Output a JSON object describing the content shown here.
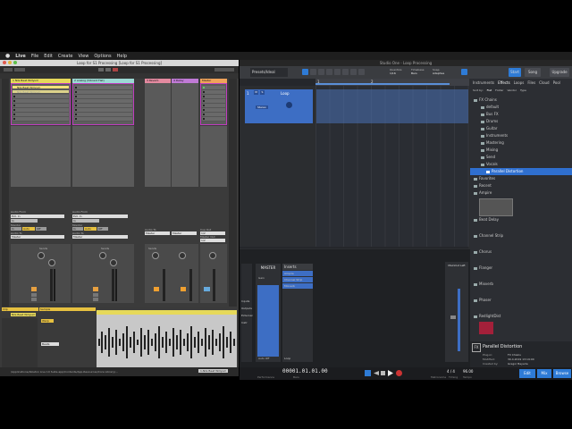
{
  "menubar": {
    "app": "Live",
    "items": [
      "File",
      "Edit",
      "Create",
      "View",
      "Options",
      "Help"
    ]
  },
  "ableton": {
    "window_title": "Loop for S1 Processing [Loop for S1 Processing]",
    "tracks": [
      {
        "name": "1 Nils Beat Willyum",
        "color": "#e6d95a"
      },
      {
        "name": "2 analog (Vibrant Flat)",
        "color": "#9cd9d4"
      },
      {
        "name": "3 Reverb",
        "color": "#e48aa0"
      },
      {
        "name": "4 Delay",
        "color": "#c07ad6"
      },
      {
        "name": "Master",
        "color": "#f0a35a"
      }
    ],
    "clips": {
      "selected": "Nils Beat Willyum",
      "second": "Nils Beat Willyum"
    },
    "io": {
      "audio_from": "Audio From",
      "ext_in": "Ext. In",
      "monitor": "Monitor",
      "in": "In",
      "auto": "Auto",
      "off": "Off",
      "audio_to": "Audio To",
      "master": "Master",
      "sends": "Sends",
      "cue_out": "Cue Out",
      "master_out": "Master Out"
    },
    "clip_view": {
      "label": "Clip",
      "clip_name": "Nils Beat Willyum",
      "sample": "Sample",
      "warp": "Warp",
      "beats": "Beats"
    },
    "status": {
      "path": "/Applications/Ableton Live 10 Suite.app/Contents/App-Resources/Core Library/...",
      "track": "1-Nils Beat Willyum"
    }
  },
  "studio_one": {
    "window_title": "Studio One - Loop Processing",
    "toolbar": {
      "preset": "Presets/Ideal",
      "quantize_label": "Quantize",
      "quantize_value": "1/16",
      "timebase_label": "Timebase",
      "timebase_value": "Bars",
      "snap_label": "Snap",
      "snap_value": "Adaptive",
      "start": "Start",
      "song": "Song",
      "project": "Project",
      "upgrade": "Upgrade"
    },
    "track": {
      "number": "1",
      "name": "Loop",
      "mode": "Stereo"
    },
    "ruler_marks": [
      "1",
      "2"
    ],
    "browser": {
      "tabs": [
        "Instruments",
        "Effects",
        "Loops",
        "Files",
        "Cloud",
        "Pool"
      ],
      "selected_tab": "Effects",
      "sort_label": "Sort by:",
      "sort_options": [
        "Flat",
        "Folder",
        "Vendor",
        "Type"
      ],
      "tree": [
        {
          "label": "FX Chains",
          "level": 0
        },
        {
          "label": "default",
          "level": 1
        },
        {
          "label": "Bus FX",
          "level": 1
        },
        {
          "label": "Drums",
          "level": 1
        },
        {
          "label": "Guitar",
          "level": 1
        },
        {
          "label": "Instruments",
          "level": 1
        },
        {
          "label": "Mastering",
          "level": 1
        },
        {
          "label": "Mixing",
          "level": 1
        },
        {
          "label": "Send",
          "level": 1
        },
        {
          "label": "Vocals",
          "level": 1
        },
        {
          "label": "Parallel Distortion",
          "level": 2,
          "selected": true
        },
        {
          "label": "Favorites",
          "level": 0
        },
        {
          "label": "Recent",
          "level": 0
        },
        {
          "label": "Ampire",
          "level": 0
        }
      ],
      "chain_items": [
        "Beat Delay",
        "Channel Strip",
        "Chorus",
        "Flanger",
        "Mixverb",
        "Phaser",
        "RedlightDist"
      ],
      "info": {
        "title": "Parallel Distortion",
        "plugin_label": "Plug-in:",
        "plugin_value": "FX Chains",
        "modified_label": "Modified:",
        "modified_value": "30.4.2019 13:19:00",
        "created_label": "Created by:",
        "created_value": "Gregor Beyerle"
      }
    },
    "mixer": {
      "channel_name": "MASTER",
      "inserts_label": "Inserts",
      "inserts": [
        "Ampire",
        "Channel Strip",
        "Mixverb"
      ],
      "channel_label": "Loop",
      "main_out": "MainOut Left",
      "gain_label": "Gain",
      "volume_readout": "Auto Off",
      "side_labels": [
        "Inputs",
        "Outputs",
        "External",
        "Instr"
      ]
    },
    "transport": {
      "time": "00001.01.01.00",
      "sub_label": "Bars",
      "performance": "Performance",
      "tempo": "96.00",
      "signature": "4 / 4",
      "metronome_label": "Metronome",
      "timing_label": "Timing",
      "tempo_label": "Tempo"
    },
    "bottom_buttons": [
      "Edit",
      "Mix",
      "Browse"
    ]
  }
}
